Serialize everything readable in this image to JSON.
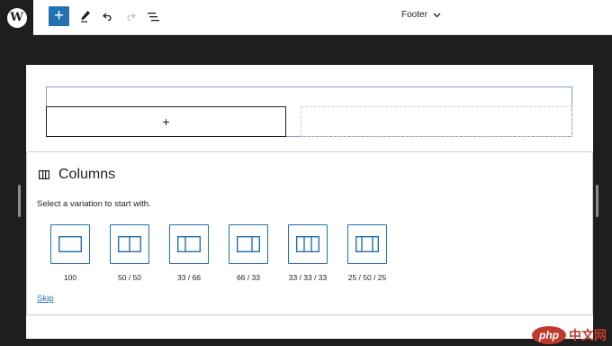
{
  "toolbar": {
    "add_icon": "+",
    "document_title": "Footer"
  },
  "panel": {
    "title": "Columns",
    "instructions": "Select a variation to start with.",
    "skip_label": "Skip",
    "variations": [
      {
        "label": "100"
      },
      {
        "label": "50 / 50"
      },
      {
        "label": "33 / 66"
      },
      {
        "label": "66 / 33"
      },
      {
        "label": "33 / 33 / 33"
      },
      {
        "label": "25 / 50 / 25"
      }
    ]
  },
  "canvas": {
    "appender_icon": "+"
  },
  "colors": {
    "accent": "#2271b1",
    "frame": "#1e1e1e"
  }
}
